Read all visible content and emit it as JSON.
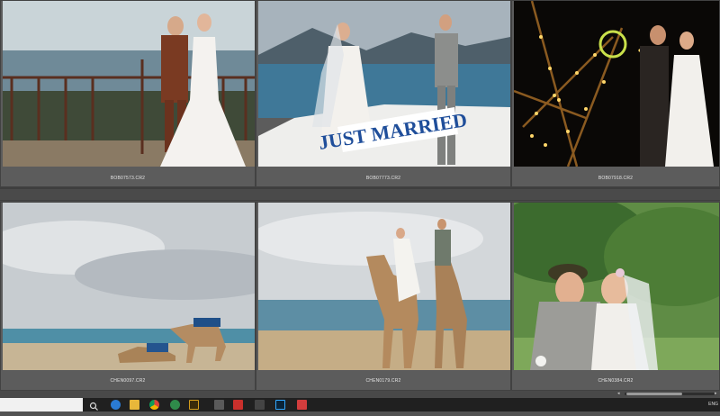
{
  "thumbnails": [
    {
      "filename": "BOB07573.CR2"
    },
    {
      "filename": "BOB07773.CR2"
    },
    {
      "filename": "BOB07918.CR2"
    },
    {
      "filename": "CHEN0097.CR2"
    },
    {
      "filename": "CHEN0179.CR2"
    },
    {
      "filename": "CHEN0384.CR2"
    }
  ],
  "photo2_sign_text": "JUST MARRIED",
  "taskbar": {
    "tray_label": "ENG",
    "icons": [
      "start-icon",
      "search-icon",
      "task-view-icon",
      "edge-icon",
      "explorer-icon",
      "chrome-icon",
      "maps-icon",
      "bridge-icon",
      "app-icon",
      "photoshop-icon",
      "app-icon",
      "app-icon"
    ]
  },
  "colors": {
    "panel": "#535353",
    "cell": "#5c5c5c",
    "taskbar": "#202020"
  }
}
